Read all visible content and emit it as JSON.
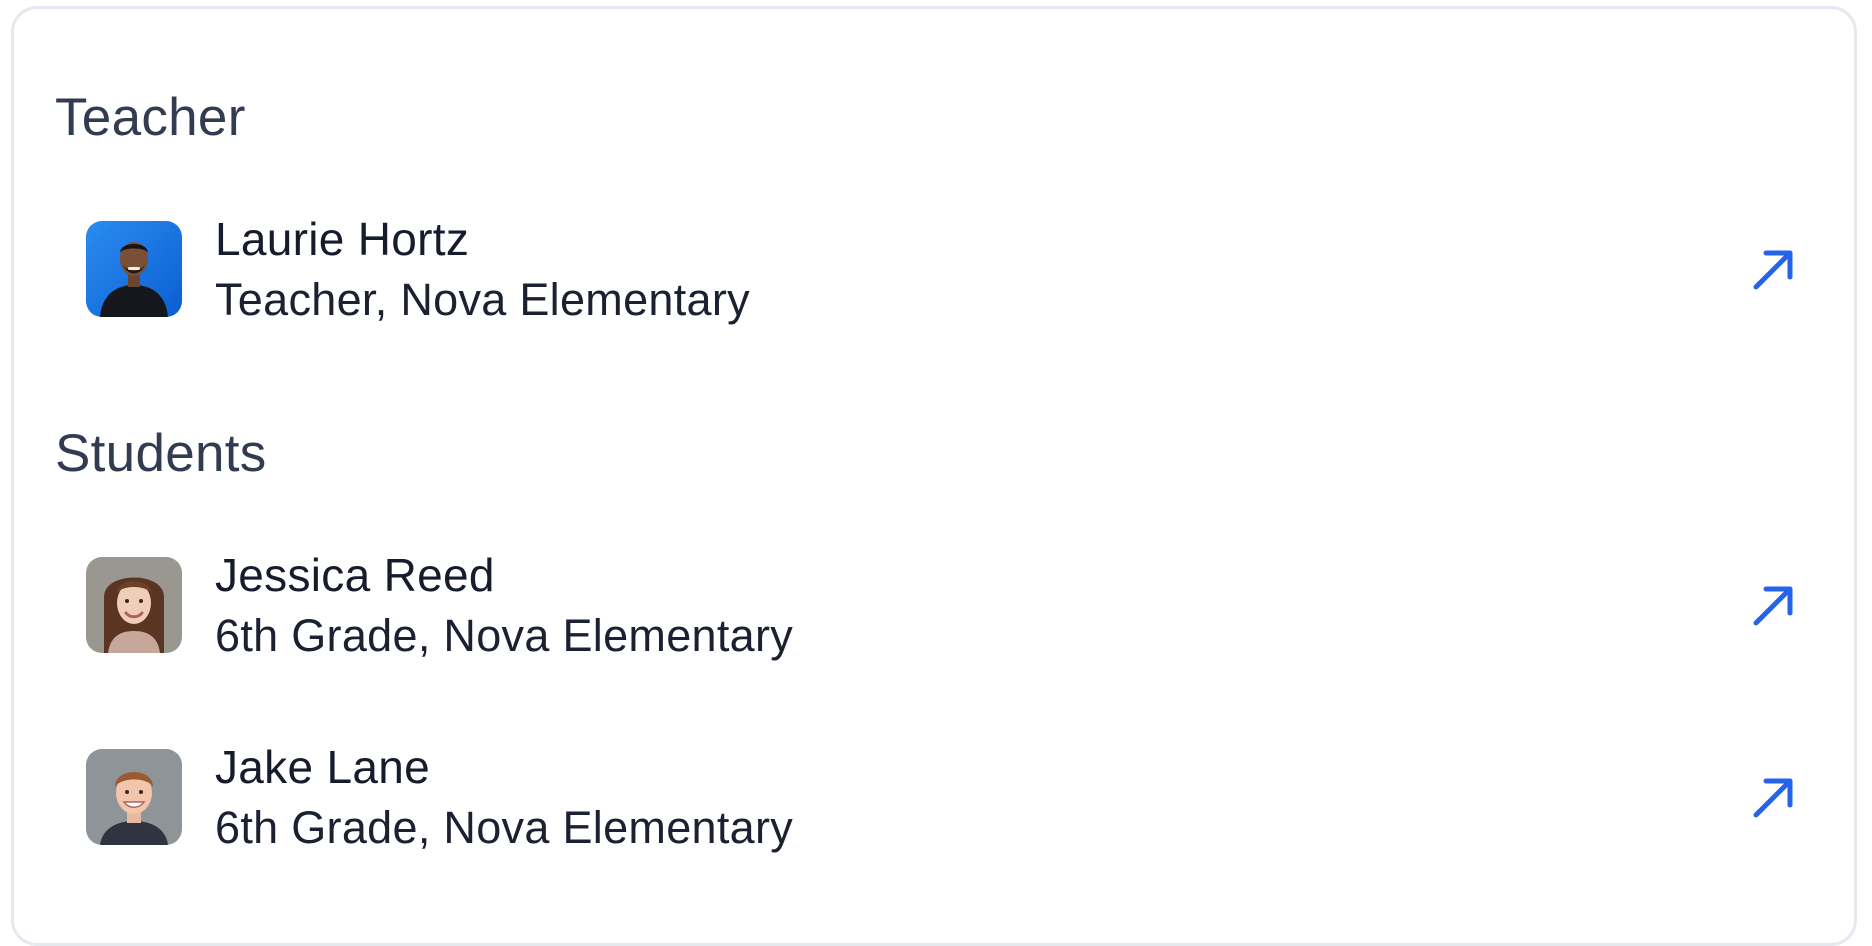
{
  "colors": {
    "accent": "#2563eb",
    "heading": "#323c51",
    "text": "#161c2b",
    "border": "#e4e9ef"
  },
  "teacher_section": {
    "title": "Teacher",
    "items": [
      {
        "name": "Laurie Hortz",
        "subtitle": "Teacher, Nova Elementary",
        "icon": "arrow-up-right-icon"
      }
    ]
  },
  "students_section": {
    "title": "Students",
    "items": [
      {
        "name": "Jessica Reed",
        "subtitle": "6th Grade, Nova Elementary",
        "icon": "arrow-up-right-icon"
      },
      {
        "name": "Jake Lane",
        "subtitle": "6th Grade, Nova Elementary",
        "icon": "arrow-up-right-icon"
      }
    ]
  }
}
